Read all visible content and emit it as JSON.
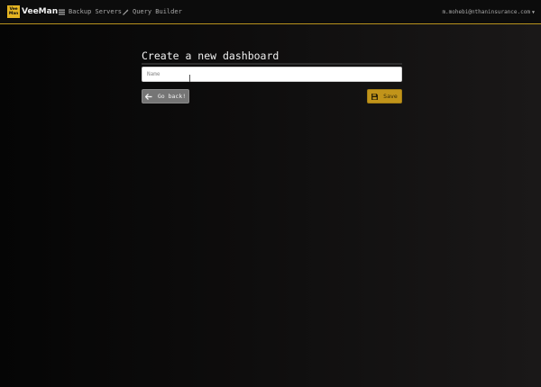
{
  "app": {
    "logo_top": "Vee",
    "logo_bottom": "Man",
    "brand": "VeeMan"
  },
  "nav": {
    "backup_servers": "Backup Servers",
    "query_builder": "Query Builder",
    "user": "m.mohebi@nthaninsurance.com"
  },
  "form": {
    "title": "Create a new dashboard",
    "name_placeholder": "Name",
    "name_value": ""
  },
  "buttons": {
    "back": "Go back!",
    "save": "Save"
  },
  "colors": {
    "accent": "#e4b422",
    "save_button": "#c1941a",
    "back_button": "#757575"
  },
  "icons": {
    "backup_servers": "list-icon",
    "query_builder": "magic-wand-icon",
    "back": "arrow-left-icon",
    "save": "floppy-disk-icon"
  }
}
